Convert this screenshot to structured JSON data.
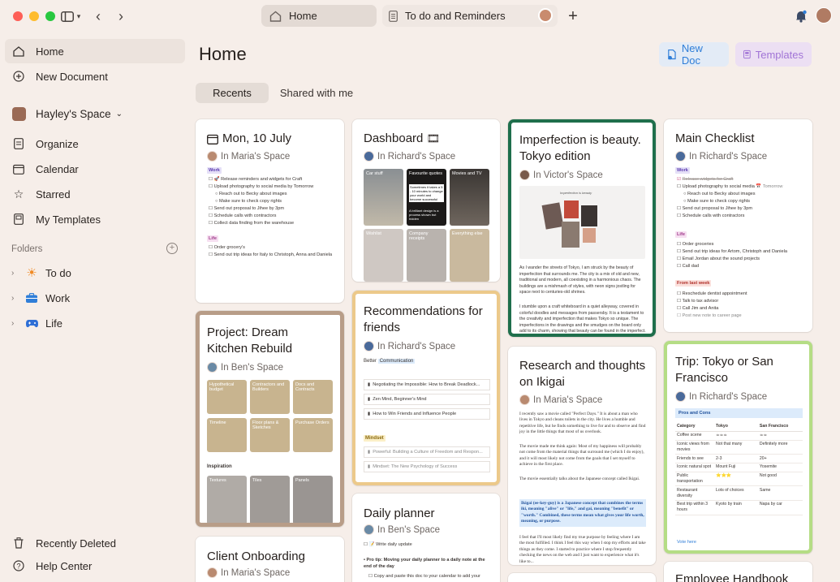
{
  "colors": {
    "bg": "#f6eee9",
    "accent_blue": "#2f7ed8",
    "accent_purple": "#a174d6",
    "green": "#1f6f4c"
  },
  "tabs": [
    {
      "label": "Home",
      "icon": "house-icon"
    },
    {
      "label": "To do and Reminders",
      "icon": "document-icon"
    }
  ],
  "sidebar": {
    "home": "Home",
    "new_document": "New Document",
    "space": "Hayley's Space",
    "organize": "Organize",
    "calendar": "Calendar",
    "starred": "Starred",
    "my_templates": "My Templates",
    "folders_label": "Folders",
    "folders": [
      {
        "label": "To do",
        "icon": "sun-icon"
      },
      {
        "label": "Work",
        "icon": "briefcase-icon"
      },
      {
        "label": "Life",
        "icon": "gamepad-icon"
      }
    ],
    "recently_deleted": "Recently Deleted",
    "help_center": "Help Center"
  },
  "main": {
    "title": "Home",
    "new_doc": "New Doc",
    "templates": "Templates",
    "segments": {
      "recents": "Recents",
      "shared": "Shared with me"
    }
  },
  "cards": {
    "mon": {
      "title": "Mon, 10 July",
      "space": "In Maria's Space",
      "work_tag": "Work",
      "work_items": [
        "Release reminders and widgets for Craft",
        "Upload photography to social media by Tomorrow",
        "Reach out to Becky about images",
        "Make sure to check copy rights",
        "Send out proposal to Jihee by 3pm",
        "Schedule calls with contractors",
        "Collect data finding from the warehouse"
      ],
      "life_tag": "Life",
      "life_items": [
        "Order grocery's",
        "Send out trip ideas for Italy to Christoph, Anna and Daniela"
      ]
    },
    "dashboard": {
      "title": "Dashboard",
      "space": "In Richard's Space",
      "thumbs": [
        "Car stuff",
        "Favourite quotes",
        "Movies and TV",
        "Wishlist",
        "Company receipts",
        "Everything else"
      ],
      "quote1": "Sometimes it takes a 5 - 10 minutes to change your world and become successful",
      "quote2": "A brilliant design is a process shown but hidden"
    },
    "imperfection": {
      "title": "Imperfection is beauty. Tokyo edition",
      "space": "In Victor's Space",
      "image_caption": "Imperfection is beauty",
      "p1": "As I wander the streets of Tokyo, I am struck by the beauty of imperfection that surrounds me. The city is a mix of old and new, traditional and modern, all coexisting in a harmonious chaos. The buildings are a mishmash of styles, with neon signs jostling for space next to centuries-old shrines.",
      "p2": "I stumble upon a craft whiteboard in a quiet alleyway, covered in colorful doodles and messages from passersby. It is a testament to the creativity and imperfection that makes Tokyo so unique. The imperfections in the drawings and the smudges on the board only add to its charm, showing that beauty can be found in the imperfect."
    },
    "checklist": {
      "title": "Main Checklist",
      "space": "In Richard's Space",
      "work_tag": "Work",
      "work_items": [
        "Release widgets for Craft",
        "Upload photography to social media",
        "Reach out to Becky about images",
        "Make sure to check copy rights",
        "Send out proposal to Jihee by 3pm",
        "Schedule calls with contractors"
      ],
      "work_date": "Tomorrow",
      "life_tag": "Life",
      "life_items": [
        "Order groceries",
        "Send out trip ideas for Artom, Christoph and Daniela",
        "Email Jordan about the sound projects",
        "Call dad"
      ],
      "last_week_tag": "From last week",
      "last_week_items": [
        "Reschedule dentist appointment",
        "Talk to tax advisor",
        "Call Jim and Anita",
        "Post new note to career page"
      ]
    },
    "kitchen": {
      "title": "Project: Dream Kitchen Rebuild",
      "space": "In Ben's Space",
      "thumbs": [
        "Hypothetical budget",
        "Contractors and Builders",
        "Docs and Contracts",
        "Timeline",
        "Floor plans & Sketches",
        "Purchase Orders"
      ],
      "inspiration": "Inspiration",
      "insp_thumbs": [
        "Textures",
        "Tiles",
        "Panels"
      ]
    },
    "recommendations": {
      "title": "Recommendations for friends",
      "space": "In Richard's Space",
      "better_label": "Better",
      "better_tag": "Communication",
      "books": [
        "Negotiating the Impossible: How to Break Deadlock...",
        "Zen Mind, Beginner's Mind",
        "How to Win Friends and Influence People"
      ],
      "mindset_tag": "Mindset",
      "mindset_books": [
        "Powerful: Building a Culture of Freedom and Respon...",
        "Mindset: The New Psychology of Success"
      ]
    },
    "research": {
      "title": "Research and thoughts on Ikigai",
      "space": "In Maria's Space",
      "p1": "I recently saw a movie called \"Perfect Days.\" It is about a man who lives in Tokyo and cleans toilets in the city. He lives a humble and repetitive life, but he finds something to live for and to observe and find joy in the little things that most of us overlook.",
      "p2": "The movie made me think again: Most of my happiness will probably not come from the material things that surround me (which I do enjoy), and it will most likely not come from the goals that I set myself to achieve in the first place.",
      "p3": "The movie essentially talks about the Japanese concept called Ikigai.",
      "p4": "Ikigai (ee-key-guy) is a Japanese concept that combines the terms iki, meaning \"alive\" or \"life,\" and gai, meaning \"benefit\" or \"worth.\" Combined, these terms mean what gives your life worth, meaning, or purpose.",
      "p5": "I feel that I'll most likely find my true purpose by feeling where I am the most fulfilled. I think I feel this way when I stop my efforts and take things as they come. I started to practice where I stop frequently checking the news on the web and I just want to experience what it's like to..."
    },
    "trip": {
      "title": "Trip: Tokyo or San Francisco",
      "space": "In Richard's Space",
      "pros_cons": "Pros and Cons",
      "headers": [
        "Category",
        "Tokyo",
        "San Francisco"
      ],
      "rows": [
        [
          "Coffee scene",
          "☕☕☕",
          "☕☕"
        ],
        [
          "Iconic views from movies",
          "Not that many",
          "Definitely more"
        ],
        [
          "Friends to see",
          "2-3",
          "20+"
        ],
        [
          "Iconic natural spot",
          "Mount Fuji",
          "Yosemite"
        ],
        [
          "Public transportation",
          "⭐⭐⭐",
          "Not good"
        ],
        [
          "Restaurant diversity",
          "Lots of choices",
          "Same"
        ],
        [
          "Best trip within 3 hours",
          "Kyoto by train",
          "Napa by car"
        ]
      ],
      "vote": "Vote here"
    },
    "daily": {
      "title": "Daily planner",
      "space": "In Ben's Space",
      "item1": "Write daily update",
      "protip": "Pro tip: Moving your daily planner to a daily note at the end of the day",
      "item2": "Copy and paste this doc to your calendar to add your"
    },
    "client": {
      "title": "Client Onboarding",
      "space": "In Maria's Space"
    },
    "employee": {
      "title": "Employee Handbook"
    }
  }
}
